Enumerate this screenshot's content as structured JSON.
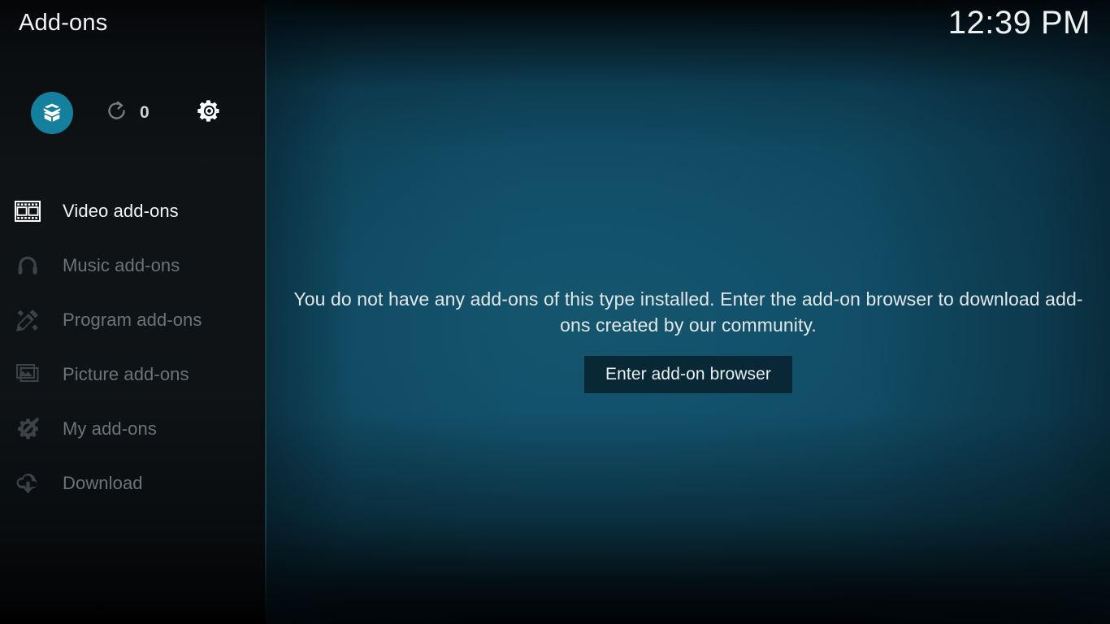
{
  "header": {
    "title": "Add-ons",
    "clock": "12:39 PM"
  },
  "toolbar": {
    "addons_browser": {
      "icon": "open-box-icon",
      "label": "Add-on browser"
    },
    "updates": {
      "icon": "refresh-icon",
      "count": "0"
    },
    "settings": {
      "icon": "gear-icon",
      "label": "Settings"
    },
    "accent_color": "#14809e"
  },
  "sidebar": {
    "items": [
      {
        "label": "Video add-ons",
        "icon": "film-strip-icon",
        "selected": true
      },
      {
        "label": "Music add-ons",
        "icon": "headphones-icon",
        "selected": false
      },
      {
        "label": "Program add-ons",
        "icon": "pencil-ruler-icon",
        "selected": false
      },
      {
        "label": "Picture add-ons",
        "icon": "picture-icon",
        "selected": false
      },
      {
        "label": "My add-ons",
        "icon": "gear-screwdriver-icon",
        "selected": false
      },
      {
        "label": "Download",
        "icon": "cloud-download-icon",
        "selected": false
      }
    ]
  },
  "main": {
    "empty_message": "You do not have any add-ons of this type installed. Enter the add-on browser to download add-ons created by our community.",
    "browse_button_label": "Enter add-on browser"
  },
  "colors": {
    "accent": "#14809e",
    "background_teal": "#14566e",
    "sidebar": "#101316",
    "text_primary": "#f0f2f3",
    "text_dim": "#6c7478"
  }
}
